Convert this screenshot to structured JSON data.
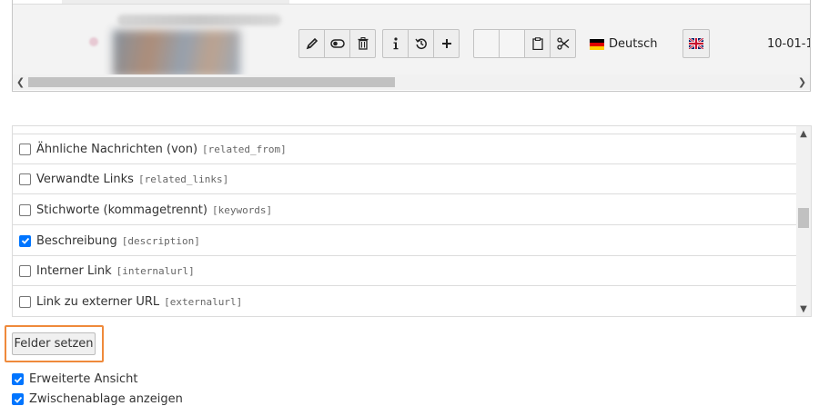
{
  "record_list": {
    "toolbar_icons": [
      "pencil-icon",
      "toggle-icon",
      "trash-icon",
      "info-icon",
      "history-icon",
      "plus-icon",
      "blank",
      "blank",
      "clipboard-icon",
      "scissors-icon"
    ],
    "language": "Deutsch",
    "date": "10-01-1"
  },
  "fields": [
    {
      "label": "Ähnliche Nachrichten (von)",
      "key": "[related_from]",
      "checked": false
    },
    {
      "label": "Verwandte Links",
      "key": "[related_links]",
      "checked": false
    },
    {
      "label": "Stichworte (kommagetrennt)",
      "key": "[keywords]",
      "checked": false
    },
    {
      "label": "Beschreibung",
      "key": "[description]",
      "checked": true
    },
    {
      "label": "Interner Link",
      "key": "[internalurl]",
      "checked": false
    },
    {
      "label": "Link zu externer URL",
      "key": "[externalurl]",
      "checked": false
    }
  ],
  "actions": {
    "set_fields_label": "Felder setzen"
  },
  "options": [
    {
      "label": "Erweiterte Ansicht",
      "checked": true
    },
    {
      "label": "Zwischenablage anzeigen",
      "checked": true
    }
  ],
  "colors": {
    "accent": "#0075ff",
    "highlight": "#ef8a3b"
  }
}
